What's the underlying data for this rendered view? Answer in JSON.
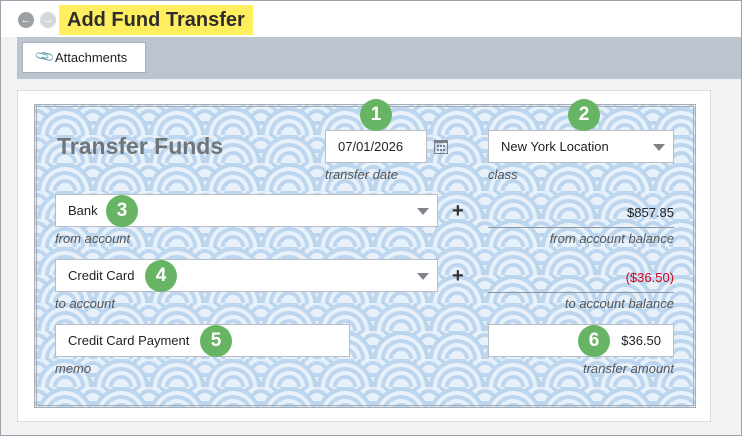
{
  "header": {
    "title": "Add Fund Transfer",
    "back_icon": "back-arrow-icon",
    "forward_icon": "forward-arrow-icon"
  },
  "toolbar": {
    "attachments_label": "Attachments",
    "attachments_icon": "paperclip-icon"
  },
  "form": {
    "title": "Transfer Funds",
    "transfer_date": {
      "value": "07/01/2026",
      "label": "transfer date"
    },
    "class": {
      "value": "New York Location",
      "label": "class"
    },
    "from_account": {
      "value": "Bank",
      "label": "from account",
      "balance": "$857.85",
      "balance_label": "from account balance"
    },
    "to_account": {
      "value": "Credit Card",
      "label": "to account",
      "balance": "($36.50)",
      "balance_label": "to account balance"
    },
    "memo": {
      "value": "Credit Card Payment",
      "label": "memo"
    },
    "transfer_amount": {
      "value": "$36.50",
      "label": "transfer amount"
    },
    "plus_symbol": "+"
  },
  "callouts": [
    "1",
    "2",
    "3",
    "4",
    "5",
    "6"
  ],
  "colors": {
    "title_highlight": "#ffef5e",
    "callout": "#67b564",
    "negative_amount": "#d0021b",
    "toolbar": "#bcc5cf"
  }
}
